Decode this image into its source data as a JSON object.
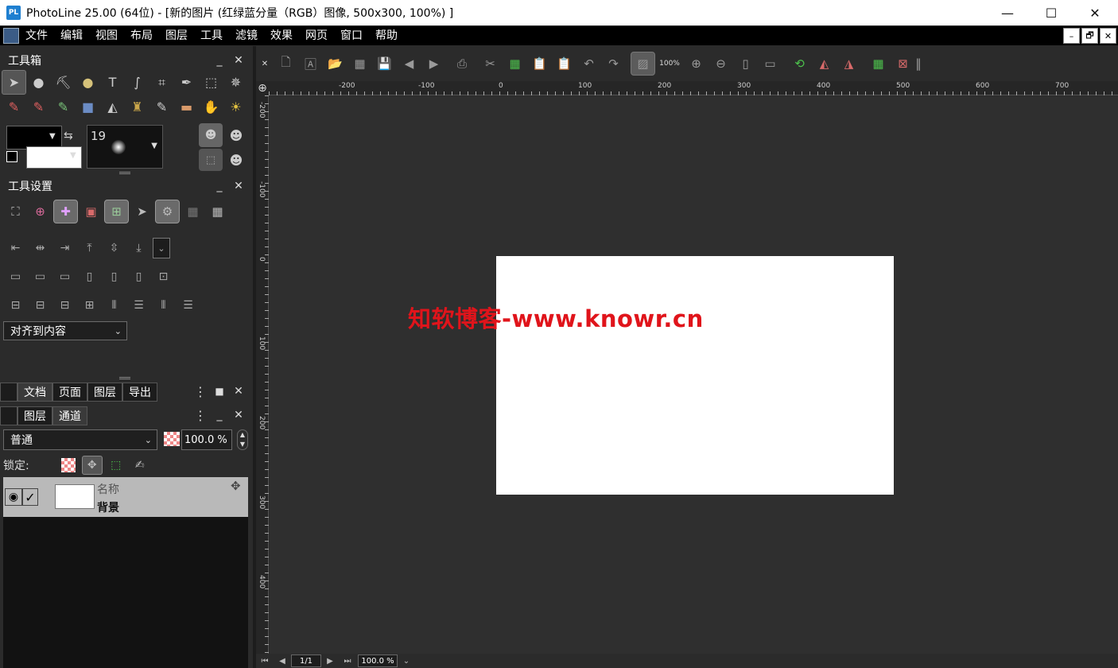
{
  "window": {
    "logo": "PL",
    "title": "PhotoLine 25.00 (64位) - [新的图片 (红绿蓝分量（RGB）图像, 500x300, 100%) ]",
    "minimize": "—",
    "maximize": "☐",
    "close": "✕"
  },
  "menu": {
    "items": [
      "文件",
      "编辑",
      "视图",
      "布局",
      "图层",
      "工具",
      "滤镜",
      "效果",
      "网页",
      "窗口",
      "帮助"
    ],
    "mdi_minimize": "–",
    "mdi_restore": "🗗",
    "mdi_close": "✕"
  },
  "toolbox": {
    "title": "工具箱",
    "minimize": "_",
    "close": "✕",
    "brush_size": "19"
  },
  "tool_settings": {
    "title": "工具设置",
    "minimize": "_",
    "close": "✕",
    "align_to": "对齐到内容"
  },
  "doc_tabs": [
    "文档",
    "页面",
    "图层",
    "导出"
  ],
  "layer_tabs": [
    "图层",
    "通道"
  ],
  "layers": {
    "blend_mode": "普通",
    "opacity": "100.0 %",
    "lock_label": "锁定:",
    "name_header": "名称",
    "rows": [
      {
        "name": "背景",
        "visible": true,
        "checked": true
      }
    ]
  },
  "toolbar": {
    "zoom_label": "100%"
  },
  "ruler": {
    "h_labels": [
      "-200",
      "-100",
      "0",
      "100",
      "200",
      "300",
      "400",
      "500",
      "600",
      "700"
    ],
    "v_labels": [
      "-200",
      "-100",
      "0",
      "100",
      "200",
      "300",
      "400"
    ]
  },
  "canvas": {
    "image_width": 500,
    "image_height": 300,
    "watermark": "知软博客-www.knowr.cn"
  },
  "status": {
    "page": "1/1",
    "zoom": "100.0 %"
  },
  "colors": {
    "background": "#2b2b2b",
    "watermark": "#e0141b",
    "accent_green": "#4cc24c"
  }
}
